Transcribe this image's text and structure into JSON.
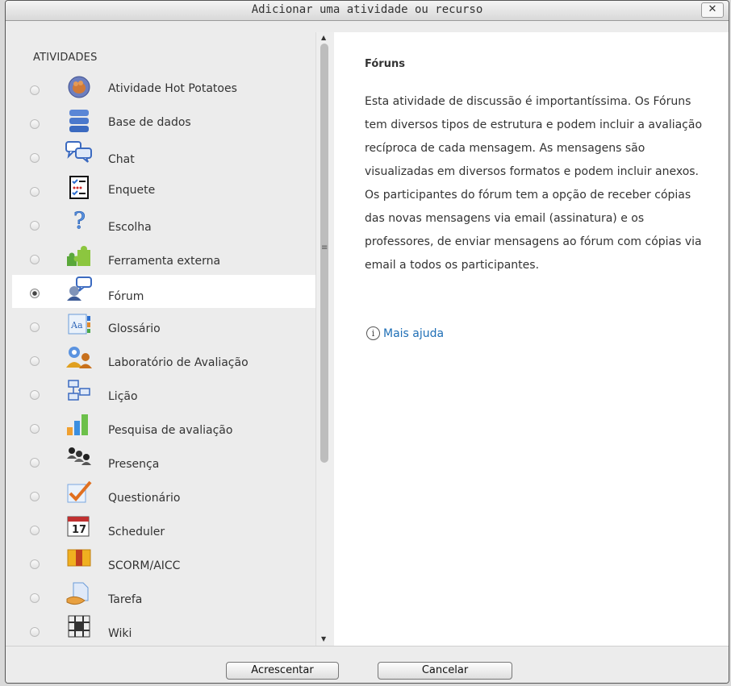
{
  "window": {
    "title": "Adicionar uma atividade ou recurso",
    "close_label": "✕"
  },
  "activities": {
    "category_label": "ATIVIDADES",
    "items": [
      {
        "label": "Atividade Hot Potatoes",
        "icon": "hot-potatoes-icon",
        "selected": false
      },
      {
        "label": "Base de dados",
        "icon": "database-icon",
        "selected": false
      },
      {
        "label": "Chat",
        "icon": "chat-icon",
        "selected": false
      },
      {
        "label": "Enquete",
        "icon": "survey-checklist-icon",
        "selected": false
      },
      {
        "label": "Escolha",
        "icon": "question-mark-icon",
        "selected": false
      },
      {
        "label": "Ferramenta externa",
        "icon": "puzzle-icon",
        "selected": false
      },
      {
        "label": "Fórum",
        "icon": "forum-icon",
        "selected": true
      },
      {
        "label": "Glossário",
        "icon": "glossary-icon",
        "selected": false
      },
      {
        "label": "Laboratório de Avaliação",
        "icon": "workshop-people-icon",
        "selected": false
      },
      {
        "label": "Lição",
        "icon": "lesson-flow-icon",
        "selected": false
      },
      {
        "label": "Pesquisa de avaliação",
        "icon": "bar-chart-icon",
        "selected": false
      },
      {
        "label": "Presença",
        "icon": "attendance-people-icon",
        "selected": false
      },
      {
        "label": "Questionário",
        "icon": "checkmark-icon",
        "selected": false
      },
      {
        "label": "Scheduler",
        "icon": "calendar-icon",
        "selected": false
      },
      {
        "label": "SCORM/AICC",
        "icon": "scorm-package-icon",
        "selected": false
      },
      {
        "label": "Tarefa",
        "icon": "assignment-icon",
        "selected": false
      },
      {
        "label": "Wiki",
        "icon": "wiki-icon",
        "selected": false
      }
    ]
  },
  "details": {
    "title": "Fóruns",
    "description": "Esta atividade de discussão é importantíssima. Os Fóruns tem diversos tipos de estrutura e podem incluir a avaliação recíproca de cada mensagem. As mensagens são visualizadas em diversos formatos e podem incluir anexos. Os participantes do fórum tem a opção de receber cópias das novas mensagens via email (assinatura) e os professores, de enviar mensagens ao fórum com cópias via email a todos os participantes.",
    "help_label": "Mais ajuda"
  },
  "footer": {
    "add_label": "Acrescentar",
    "cancel_label": "Cancelar"
  }
}
